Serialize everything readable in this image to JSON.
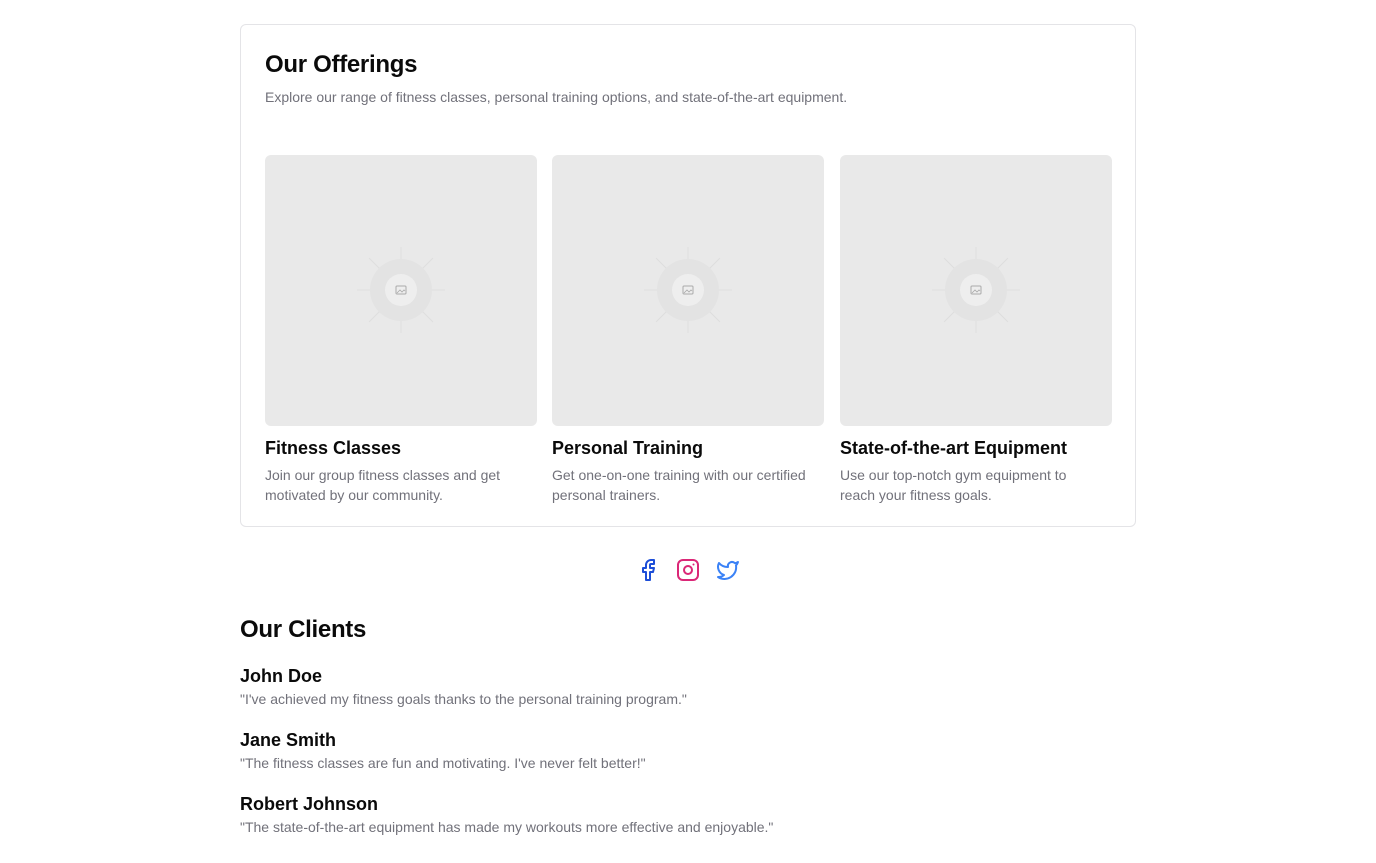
{
  "offerings": {
    "title": "Our Offerings",
    "subtitle": "Explore our range of fitness classes, personal training options, and state-of-the-art equipment.",
    "items": [
      {
        "title": "Fitness Classes",
        "description": "Join our group fitness classes and get motivated by our community.",
        "image_icon": "image-placeholder-icon"
      },
      {
        "title": "Personal Training",
        "description": "Get one-on-one training with our certified personal trainers.",
        "image_icon": "image-placeholder-icon"
      },
      {
        "title": "State-of-the-art Equipment",
        "description": "Use our top-notch gym equipment to reach your fitness goals.",
        "image_icon": "image-placeholder-icon"
      }
    ]
  },
  "social": {
    "links": [
      {
        "icon": "facebook-icon",
        "color": "#1d4ed8"
      },
      {
        "icon": "instagram-icon",
        "color": "#db2777"
      },
      {
        "icon": "twitter-icon",
        "color": "#3b82f6"
      }
    ]
  },
  "clients": {
    "title": "Our Clients",
    "items": [
      {
        "name": "John Doe",
        "quote": "\"I've achieved my fitness goals thanks to the personal training program.\""
      },
      {
        "name": "Jane Smith",
        "quote": "\"The fitness classes are fun and motivating. I've never felt better!\""
      },
      {
        "name": "Robert Johnson",
        "quote": "\"The state-of-the-art equipment has made my workouts more effective and enjoyable.\""
      }
    ]
  }
}
